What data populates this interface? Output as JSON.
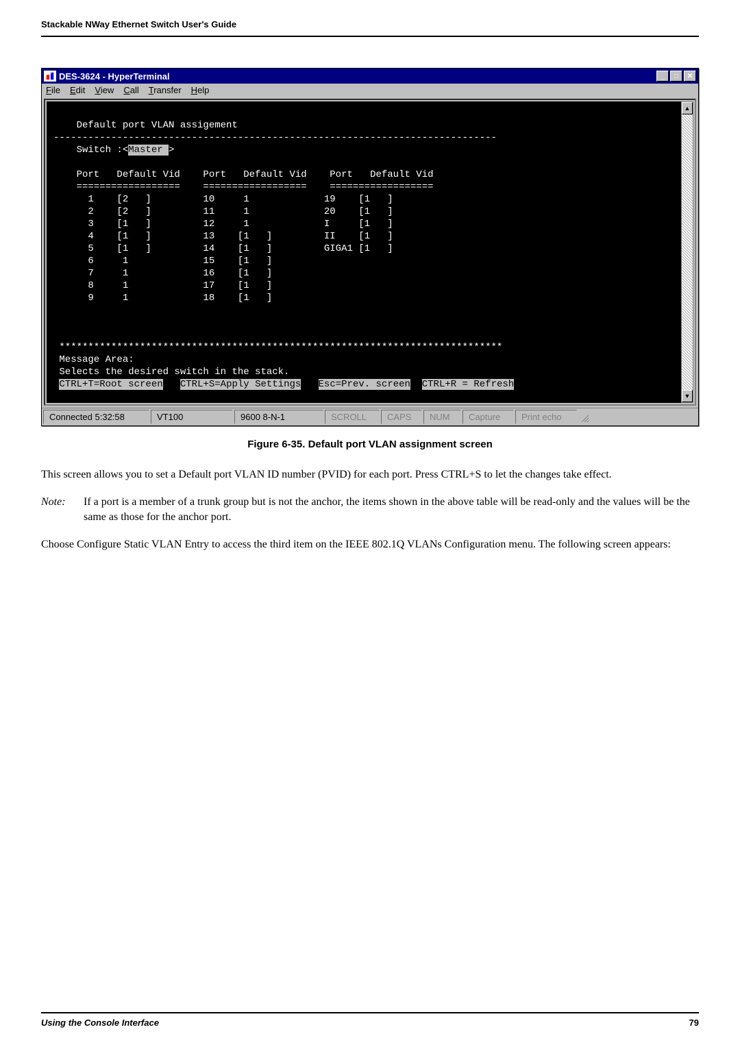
{
  "header": {
    "title": "Stackable NWay Ethernet Switch User's Guide"
  },
  "window": {
    "title": "DES-3624 - HyperTerminal",
    "menu": {
      "file": "File",
      "edit": "Edit",
      "view": "View",
      "call": "Call",
      "transfer": "Transfer",
      "help": "Help"
    }
  },
  "terminal": {
    "heading": "Default port VLAN assigement",
    "divider": "-----------------------------------------------------------------------------",
    "switch_label": "Switch :<",
    "switch_value": "Master ",
    "switch_tail": ">",
    "col_headers": {
      "c1": "Port   Default Vid",
      "c2": "Port   Default Vid",
      "c3": "Port   Default Vid"
    },
    "col_divider": "==================",
    "rows_col1": [
      {
        "p": "1",
        "v": "[2   ]"
      },
      {
        "p": "2",
        "v": "[2   ]"
      },
      {
        "p": "3",
        "v": "[1   ]"
      },
      {
        "p": "4",
        "v": "[1   ]"
      },
      {
        "p": "5",
        "v": "[1   ]"
      },
      {
        "p": "6",
        "v": " 1    "
      },
      {
        "p": "7",
        "v": " 1    "
      },
      {
        "p": "8",
        "v": " 1    "
      },
      {
        "p": "9",
        "v": " 1    "
      }
    ],
    "rows_col2": [
      {
        "p": "10",
        "v": " 1    "
      },
      {
        "p": "11",
        "v": " 1    "
      },
      {
        "p": "12",
        "v": " 1    "
      },
      {
        "p": "13",
        "v": "[1   ]"
      },
      {
        "p": "14",
        "v": "[1   ]"
      },
      {
        "p": "15",
        "v": "[1   ]"
      },
      {
        "p": "16",
        "v": "[1   ]"
      },
      {
        "p": "17",
        "v": "[1   ]"
      },
      {
        "p": "18",
        "v": "[1   ]"
      }
    ],
    "rows_col3": [
      {
        "p": "19   ",
        "v": "[1   ]"
      },
      {
        "p": "20   ",
        "v": "[1   ]"
      },
      {
        "p": "I    ",
        "v": "[1   ]"
      },
      {
        "p": "II   ",
        "v": "[1   ]"
      },
      {
        "p": "GIGA1",
        "v": "[1   ]"
      }
    ],
    "stars": "*****************************************************************************",
    "msg_label": "Message Area:",
    "msg_text": "Selects the desired switch in the stack.",
    "footer_line": {
      "root": "CTRL+T=Root screen",
      "apply": "CTRL+S=Apply Settings",
      "prev": "Esc=Prev. screen",
      "refresh": "CTRL+R = Refresh"
    }
  },
  "statusbar": {
    "connected": "Connected 5:32:58",
    "emulation": "VT100",
    "settings": "9600 8-N-1",
    "scroll": "SCROLL",
    "caps": "CAPS",
    "num": "NUM",
    "capture": "Capture",
    "print": "Print echo"
  },
  "figure_caption": "Figure 6-35.  Default port VLAN assignment screen",
  "body": {
    "p1": "This screen allows you to set a Default port VLAN ID number (PVID) for each port. Press CTRL+S to let the changes take effect.",
    "note_label": "Note:",
    "note_text": "If a port is a member of a trunk group but is not the anchor, the items shown in the above table will be read-only and the values will be the same as those for the anchor port.",
    "p2_a": "Choose Configure Static VLAN Entry to access the third item on the IEEE 802.1Q VLANs Configuration menu. The following screen appears:"
  },
  "footer": {
    "left": "Using the Console Interface",
    "right": "79"
  }
}
